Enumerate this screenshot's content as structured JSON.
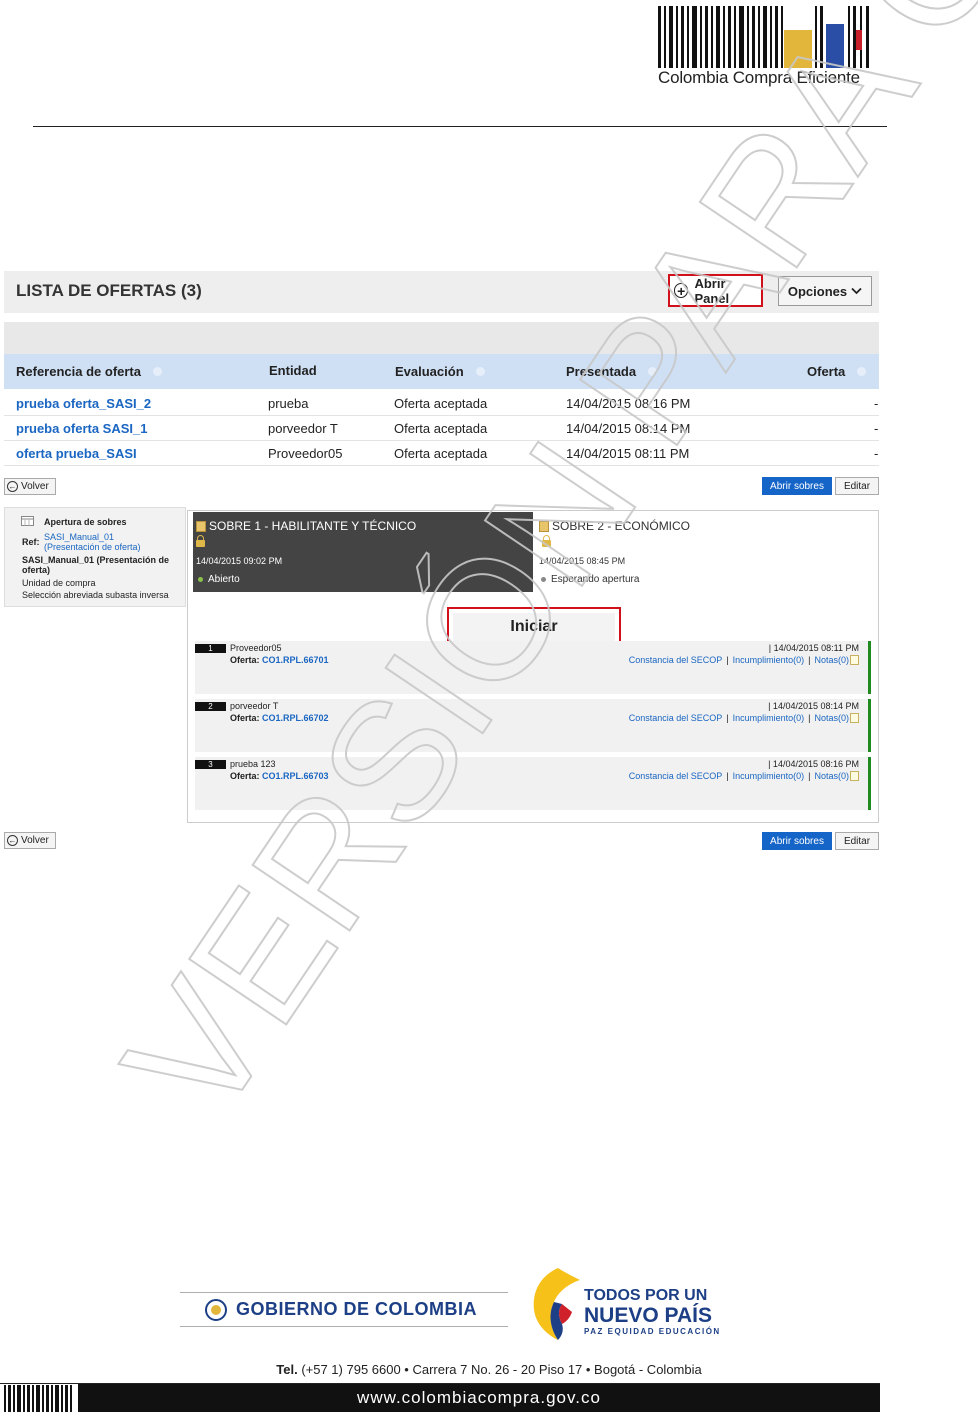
{
  "header": {
    "brand": "Colombia Compra Eficiente"
  },
  "lista": {
    "title": "LISTA DE OFERTAS (3)",
    "abrir_panel": "Abrir Panel",
    "opciones": "Opciones",
    "columns": [
      "Referencia de oferta",
      "Entidad",
      "Evaluación",
      "Presentada",
      "Oferta"
    ],
    "rows": [
      {
        "ref": "prueba oferta_SASI_2",
        "entidad": "prueba",
        "evaluacion": "Oferta aceptada",
        "presentada": "14/04/2015 08:16 PM",
        "oferta": "-"
      },
      {
        "ref": "prueba oferta SASI_1",
        "entidad": "porveedor T",
        "evaluacion": "Oferta aceptada",
        "presentada": "14/04/2015 08:14 PM",
        "oferta": "-"
      },
      {
        "ref": "oferta prueba_SASI",
        "entidad": "Proveedor05",
        "evaluacion": "Oferta aceptada",
        "presentada": "14/04/2015 08:11 PM",
        "oferta": "-"
      }
    ]
  },
  "buttons": {
    "volver": "Volver",
    "abrir_sobres": "Abrir sobres",
    "editar": "Editar"
  },
  "ref_card": {
    "title": "Apertura de sobres",
    "ref_label": "Ref:",
    "ref_link1": "SASI_Manual_01",
    "ref_link2": "(Presentación de oferta)",
    "ref_name": "SASI_Manual_01 (Presentación de oferta)",
    "unit": "Unidad de compra",
    "process": "Selección abreviada subasta inversa"
  },
  "sobres": [
    {
      "title": "SOBRE 1 - HABILITANTE Y TÉCNICO",
      "date": "14/04/2015 09:02 PM",
      "status": "Abierto",
      "status_color": "#8bc34a"
    },
    {
      "title": "SOBRE 2 - ECONÓMICO",
      "date": "14/04/2015 08:45 PM",
      "status": "Esperando apertura",
      "status_color": "#888888"
    }
  ],
  "iniciar": "Iniciar",
  "oferta_label": "Oferta:",
  "bids": [
    {
      "num": "1",
      "name": "Proveedor05",
      "code": "CO1.RPL.66701",
      "date": "| 14/04/2015 08:11 PM",
      "constancia": "Constancia del SECOP",
      "incumplimiento": "Incumplimiento(0)",
      "notas": "Notas(0)"
    },
    {
      "num": "2",
      "name": "porveedor T",
      "code": "CO1.RPL.66702",
      "date": "| 14/04/2015 08:14 PM",
      "constancia": "Constancia del SECOP",
      "incumplimiento": "Incumplimiento(0)",
      "notas": "Notas(0)"
    },
    {
      "num": "3",
      "name": "prueba 123",
      "code": "CO1.RPL.66703",
      "date": "| 14/04/2015 08:16 PM",
      "constancia": "Constancia del SECOP",
      "incumplimiento": "Incumplimiento(0)",
      "notas": "Notas(0)"
    }
  ],
  "watermark": "VERSIÓN PARA COMENTARIOS",
  "footer": {
    "gobierno": "GOBIERNO DE COLOMBIA",
    "todos_line1": "TODOS POR UN",
    "todos_line2": "NUEVO PAÍS",
    "todos_line3": "PAZ EQUIDAD EDUCACIÓN",
    "tel_bold": "Tel.",
    "tel_rest": " (+57 1) 795 6600 • Carrera 7 No. 26 - 20 Piso 17 • Bogotá - Colombia",
    "website": "www.colombiacompra.gov.co"
  },
  "colors": {
    "accent_blue": "#1565c8",
    "highlight_red": "#d0101b",
    "brand_navy": "#1d3f86"
  }
}
